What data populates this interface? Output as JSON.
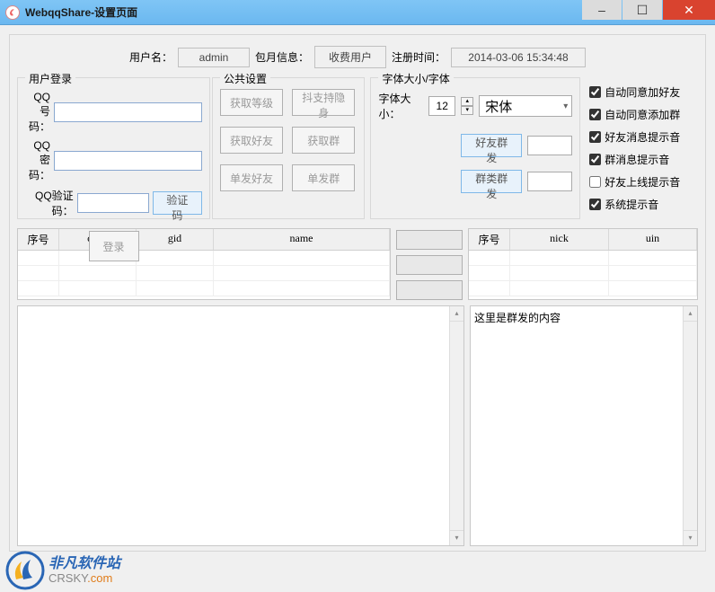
{
  "window": {
    "title": "WebqqShare-设置页面"
  },
  "top": {
    "username_label": "用户名：",
    "username_value": "admin",
    "billing_label": "包月信息：",
    "billing_value": "收费用户",
    "regtime_label": "注册时间：",
    "regtime_value": "2014-03-06 15:34:48"
  },
  "login": {
    "title": "用户登录",
    "qq_number_label": "QQ 号 码：",
    "qq_password_label": "QQ 密  码：",
    "qq_captcha_label": "QQ验证码：",
    "captcha_btn": "验证码",
    "login_btn": "登录"
  },
  "public": {
    "title": "公共设置",
    "get_level": "获取等级",
    "shake_hide": "抖支持隐身",
    "get_friends": "获取好友",
    "get_groups": "获取群",
    "send_friend": "单发好友",
    "send_group": "单发群"
  },
  "font": {
    "title": "字体大小/字体",
    "size_label": "字体大小：",
    "size_value": "12",
    "family_value": "宋体",
    "friend_mass": "好友群发",
    "group_mass": "群类群发"
  },
  "checks": {
    "auto_friend": "自动同意加好友",
    "auto_group": "自动同意添加群",
    "friend_msg_sound": "好友消息提示音",
    "group_msg_sound": "群消息提示音",
    "friend_online_sound": "好友上线提示音",
    "system_sound": "系统提示音"
  },
  "grid1": {
    "cols": [
      "序号",
      "code",
      "gid",
      "name"
    ]
  },
  "grid2": {
    "cols": [
      "序号",
      "nick",
      "uin"
    ]
  },
  "textarea2_placeholder": "这里是群发的内容",
  "watermark": {
    "cn": "非凡软件站",
    "en_a": "CRSKY",
    "en_b": ".com"
  }
}
